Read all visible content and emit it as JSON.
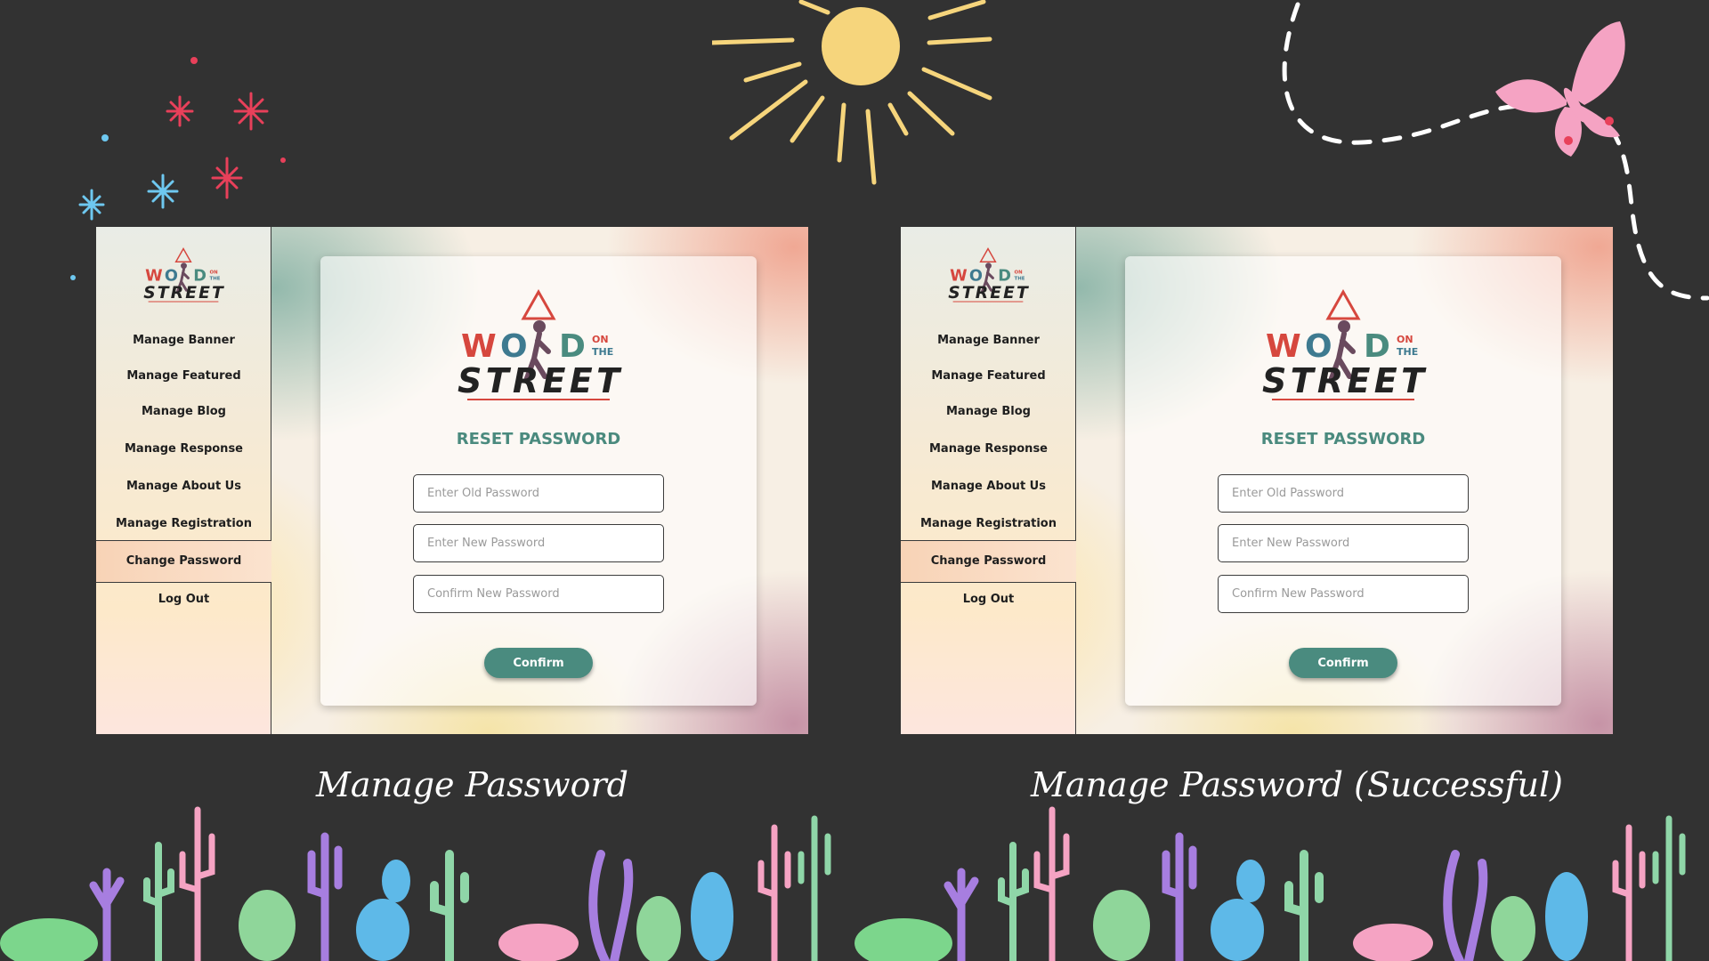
{
  "colors": {
    "background": "#323232",
    "accent": "#4a8b7f",
    "title": "#4a8a7e",
    "active_menu": "#f8d3b6"
  },
  "logo": {
    "letters": [
      "W",
      "O",
      "D"
    ],
    "small": [
      "ON",
      "THE"
    ],
    "street": "STREET",
    "letter_colors": [
      "#d6473e",
      "#3e7a90",
      "#4a8b7f"
    ]
  },
  "panels": [
    {
      "menu": [
        {
          "label": "Manage Banner",
          "active": false
        },
        {
          "label": "Manage Featured",
          "active": false
        },
        {
          "label": "Manage Blog",
          "active": false
        },
        {
          "label": "Manage Response",
          "active": false
        },
        {
          "label": "Manage About Us",
          "active": false
        },
        {
          "label": "Manage Registration",
          "active": false
        },
        {
          "label": "Change Password",
          "active": true
        },
        {
          "label": "Log Out",
          "active": false
        }
      ],
      "title": "RESET PASSWORD",
      "fields": [
        {
          "placeholder": "Enter Old Password",
          "value": ""
        },
        {
          "placeholder": "Enter New Password",
          "value": ""
        },
        {
          "placeholder": "Confirm New Password",
          "value": ""
        }
      ],
      "button": "Confirm",
      "caption": "Manage Password"
    },
    {
      "menu": [
        {
          "label": "Manage Banner",
          "active": false
        },
        {
          "label": "Manage Featured",
          "active": false
        },
        {
          "label": "Manage Blog",
          "active": false
        },
        {
          "label": "Manage Response",
          "active": false
        },
        {
          "label": "Manage About Us",
          "active": false
        },
        {
          "label": "Manage Registration",
          "active": false
        },
        {
          "label": "Change Password",
          "active": true
        },
        {
          "label": "Log Out",
          "active": false
        }
      ],
      "title": "RESET PASSWORD",
      "fields": [
        {
          "placeholder": "Enter Old Password",
          "value": ""
        },
        {
          "placeholder": "Enter New Password",
          "value": ""
        },
        {
          "placeholder": "Confirm New Password",
          "value": ""
        }
      ],
      "button": "Confirm",
      "caption": "Manage Password (Successful)"
    }
  ],
  "decorations": [
    "sparkle-stars",
    "chalk-sun",
    "pink-butterfly",
    "dashed-flight-path",
    "cactus-border"
  ]
}
